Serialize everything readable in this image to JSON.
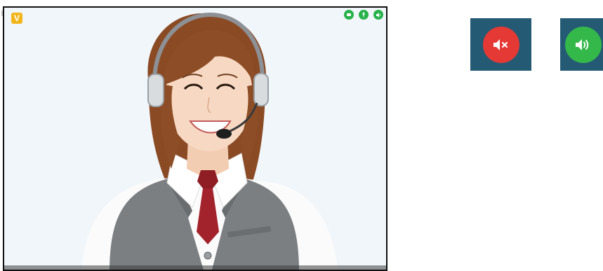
{
  "video_panel": {
    "brand_badge": "V",
    "controls": [
      {
        "icon": "camera-icon"
      },
      {
        "icon": "microphone-icon"
      },
      {
        "icon": "speaker-icon"
      }
    ],
    "accent_color": "#27b24a",
    "badge_color": "#f2b51c"
  },
  "sample_buttons": {
    "mute": {
      "icon": "speaker-muted-icon",
      "color": "#e53935",
      "tile_color": "#255a74"
    },
    "unmute": {
      "icon": "speaker-on-icon",
      "color": "#34b84a",
      "tile_color": "#255a74"
    }
  }
}
